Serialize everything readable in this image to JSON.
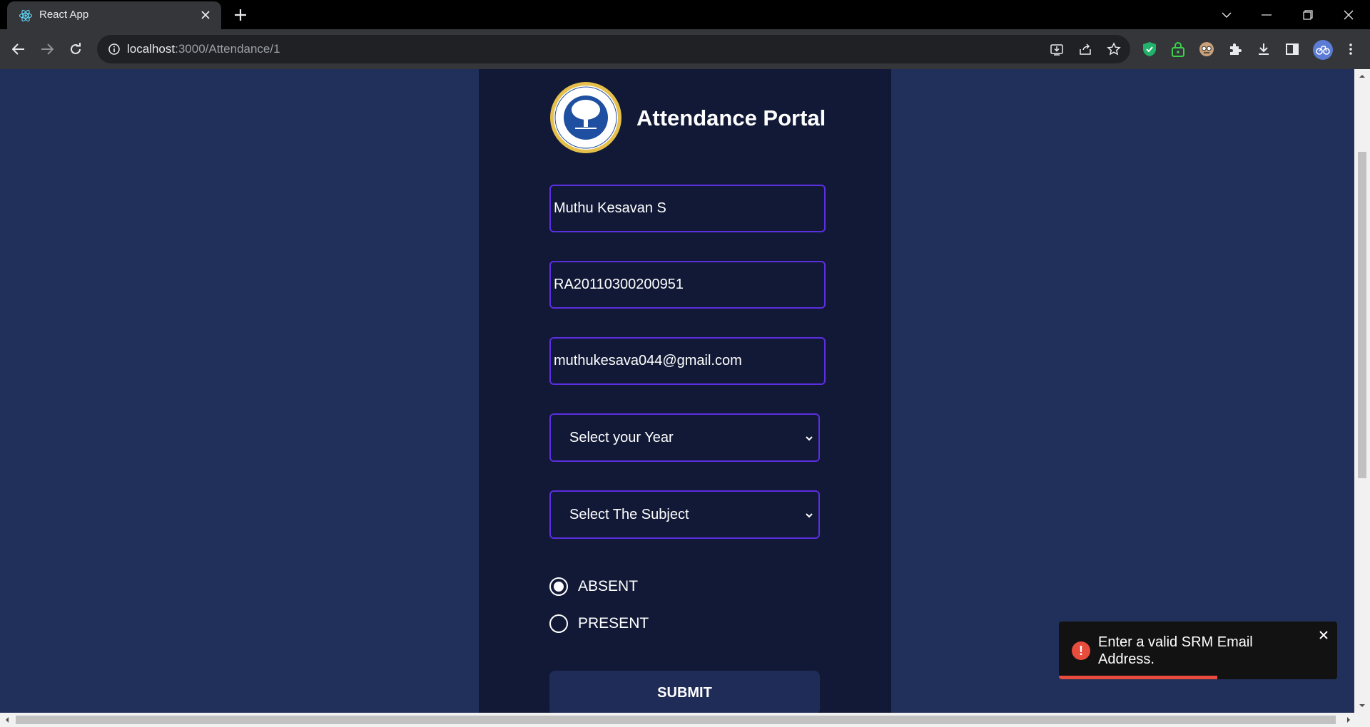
{
  "browser": {
    "tab_title": "React App",
    "url_host": "localhost",
    "url_path": ":3000/Attendance/1"
  },
  "page": {
    "title": "Attendance Portal",
    "logo_icon": "university-seal-icon",
    "fields": {
      "name_value": "Muthu Kesavan S",
      "reg_value": "RA20110300200951",
      "email_value": "muthukesava044@gmail.com"
    },
    "year_select": {
      "selected": "Select your Year"
    },
    "subject_select": {
      "selected": "Select The Subject"
    },
    "radios": [
      {
        "label": "ABSENT",
        "checked": true
      },
      {
        "label": "PRESENT",
        "checked": false
      }
    ],
    "submit_label": "SUBMIT"
  },
  "toast": {
    "message": "Enter a valid SRM Email Address.",
    "type": "error",
    "progress_fraction": 0.57
  },
  "colors": {
    "page_bg": "#21305a",
    "panel_bg": "#111936",
    "field_border": "#5b2ee0",
    "toast_error": "#e74c3c"
  }
}
